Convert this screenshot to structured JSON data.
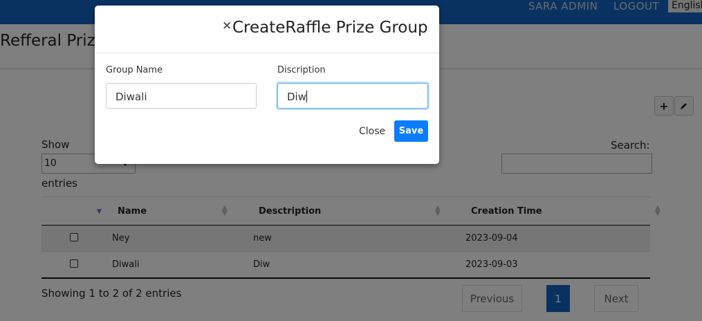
{
  "header": {
    "user_label": "SARA ADMIN",
    "logout_label": "LOGOUT",
    "language_label": "English"
  },
  "page": {
    "title": "Refferal Prize Group",
    "add_icon": "plus-icon",
    "edit_icon": "pencil-icon"
  },
  "table_controls": {
    "show_label": "Show",
    "entries_label": "entries",
    "page_size_value": "10",
    "search_label": "Search:",
    "search_value": ""
  },
  "table": {
    "columns": [
      "",
      "Name",
      "Desctription",
      "Creation Time"
    ],
    "rows": [
      {
        "checked": false,
        "name": "Ney",
        "description": "new",
        "created": "2023-09-04"
      },
      {
        "checked": false,
        "name": "Diwali",
        "description": "Diw",
        "created": "2023-09-03"
      }
    ]
  },
  "footer": {
    "info": "Showing 1 to 2 of 2 entries",
    "prev_label": "Previous",
    "current_page": "1",
    "next_label": "Next"
  },
  "modal": {
    "close_icon": "close-icon",
    "close_glyph": "×",
    "title": "CreateRaffle Prize Group",
    "group_name_label": "Group Name",
    "group_name_value": "Diwali",
    "description_label": "Discription",
    "description_value": "Diw",
    "close_label": "Close",
    "save_label": "Save"
  },
  "colors": {
    "topbar": "#1565c0",
    "save_button": "#0b7dfc",
    "current_page": "#1565c0"
  }
}
